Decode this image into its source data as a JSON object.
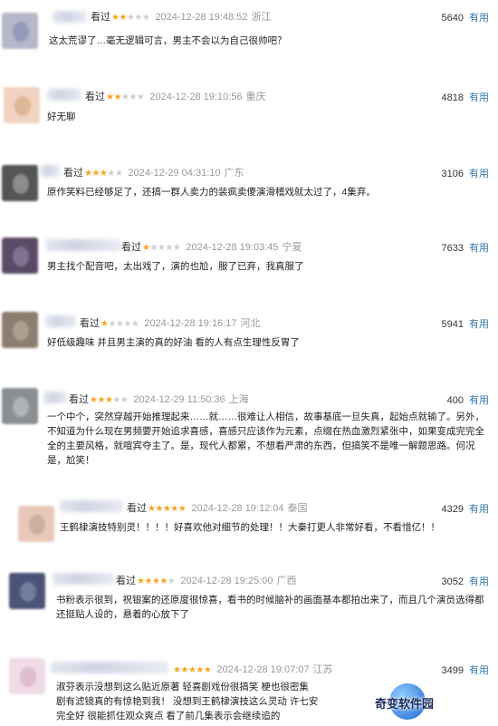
{
  "useful_label": "有用",
  "watched_label": "看过",
  "comments": [
    {
      "stars": 2,
      "time": "2024-12-28 19:48:52",
      "location": "浙江",
      "votes": "5640",
      "text": "这太荒谬了…毫无逻辑可言，男主不会以为自己很帅吧？",
      "colors": [
        "#8a95b6",
        "#b5b8c8"
      ]
    },
    {
      "stars": 2,
      "time": "2024-12-28 19:10:56",
      "location": "重庆",
      "votes": "4818",
      "text": "好无聊",
      "colors": [
        "#d9b08c",
        "#f0d3c0"
      ]
    },
    {
      "stars": 3,
      "time": "2024-12-29 04:31:10",
      "location": "广东",
      "votes": "3106",
      "text": "原作笑料已经够足了，还搞一群人卖力的装疯卖傻演滑稽戏就太过了，4集弃。",
      "colors": [
        "#9a9a9a",
        "#555555"
      ]
    },
    {
      "stars": 1,
      "time": "2024-12-28 19:03:45",
      "location": "宁夏",
      "votes": "7633",
      "text": "男主找个配音吧，太出戏了，演的也尬，服了已弃，我真服了",
      "colors": [
        "#8b7aa0",
        "#5b4a66"
      ]
    },
    {
      "stars": 1,
      "time": "2024-12-28 19:16:17",
      "location": "河北",
      "votes": "5941",
      "text": "好低级趣味 并且男主演的真的好油 看的人有点生理性反胃了",
      "colors": [
        "#b2a79a",
        "#8d7d6e"
      ]
    },
    {
      "stars": 3,
      "time": "2024-12-29 11:50:36",
      "location": "上海",
      "votes": "400",
      "text": "一个中个，突然穿越开始推理起来……就……很难让人相信，故事基底一旦失真，起始点就输了。另外，不知道为什么现在男频要开始追求喜感，喜感只应该作为元素，点缀在热血激烈紧张中，如果变成完完全全的主要风格，就喧宾夺主了。是，现代人都累，不想看严肃的东西，但搞笑不是唯一解题思路。何况是，尬笑！",
      "colors": [
        "#b9bcc0",
        "#8a8f94"
      ]
    },
    {
      "stars": 5,
      "time": "2024-12-28 19:12:04",
      "location": "泰国",
      "votes": "4329",
      "text": "王鹤棣演技特别灵！！！！好喜欢他对细节的处理！！大秦打更人非常好看，不看惜亿！！",
      "colors": [
        "#c5a79a",
        "#e8c8b8"
      ]
    },
    {
      "stars": 4,
      "time": "2024-12-28 19:25:00",
      "location": "广西",
      "votes": "3052",
      "text": "书粉表示很到，祝银案的还原度很惊喜，看书的时候脑补的画面基本都拍出来了，而且几个演员选得都还挺贴人设的，悬着的心放下了",
      "colors": [
        "#7d86a8",
        "#4a5478"
      ]
    },
    {
      "stars": 5,
      "time": "2024-12-28 19:07:07",
      "location": "江苏",
      "votes": "3499",
      "text": "淑芬表示没想到这么贴近原著 轻喜剧戏份很搞笑 梗也很密集 剧有滤镜真的有惊艳到我！ 没想到王鹤棣演技这么灵动 许七安完全好 很能抓住观众爽点 看了前几集表示会继续追的",
      "colors": [
        "#d8b5c8",
        "#f0dbe6"
      ]
    }
  ],
  "watermark": {
    "text": "奇变软件园"
  }
}
